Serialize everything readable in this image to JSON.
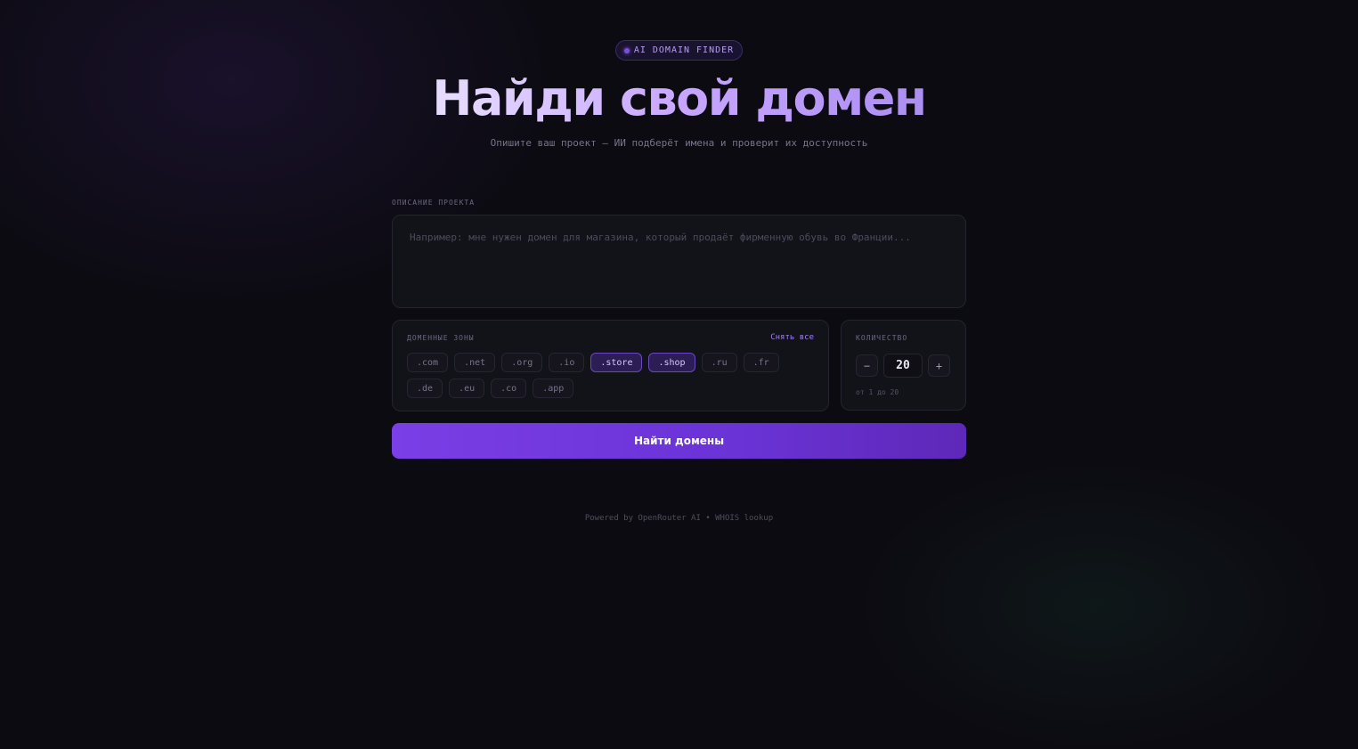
{
  "header": {
    "badge": "AI DOMAIN FINDER",
    "title": "Найди свой домен",
    "subtitle": "Опишите ваш проект — ИИ подберёт имена и проверит их доступность"
  },
  "description": {
    "label": "ОПИСАНИЕ ПРОЕКТА",
    "value": "",
    "placeholder": "Например: мне нужен домен для магазина, который продаёт фирменную обувь во Франции..."
  },
  "zones": {
    "label": "ДОМЕННЫЕ ЗОНЫ",
    "clear_all": "Снять все",
    "items": [
      {
        "label": ".com",
        "selected": false
      },
      {
        "label": ".net",
        "selected": false
      },
      {
        "label": ".org",
        "selected": false
      },
      {
        "label": ".io",
        "selected": false
      },
      {
        "label": ".store",
        "selected": true
      },
      {
        "label": ".shop",
        "selected": true
      },
      {
        "label": ".ru",
        "selected": false
      },
      {
        "label": ".fr",
        "selected": false
      },
      {
        "label": ".de",
        "selected": false
      },
      {
        "label": ".eu",
        "selected": false
      },
      {
        "label": ".co",
        "selected": false
      },
      {
        "label": ".app",
        "selected": false
      }
    ]
  },
  "count": {
    "label": "КОЛИЧЕСТВО",
    "value": "20",
    "minus": "−",
    "plus": "+",
    "hint": "от 1 до 20"
  },
  "submit": {
    "label": "Найти домены"
  },
  "footer": {
    "text": "Powered by OpenRouter AI • WHOIS lookup"
  },
  "colors": {
    "accent": "#7a3fe6",
    "background": "#0c0b12",
    "panel": "#121219",
    "chip_active": "#2d1d55"
  }
}
